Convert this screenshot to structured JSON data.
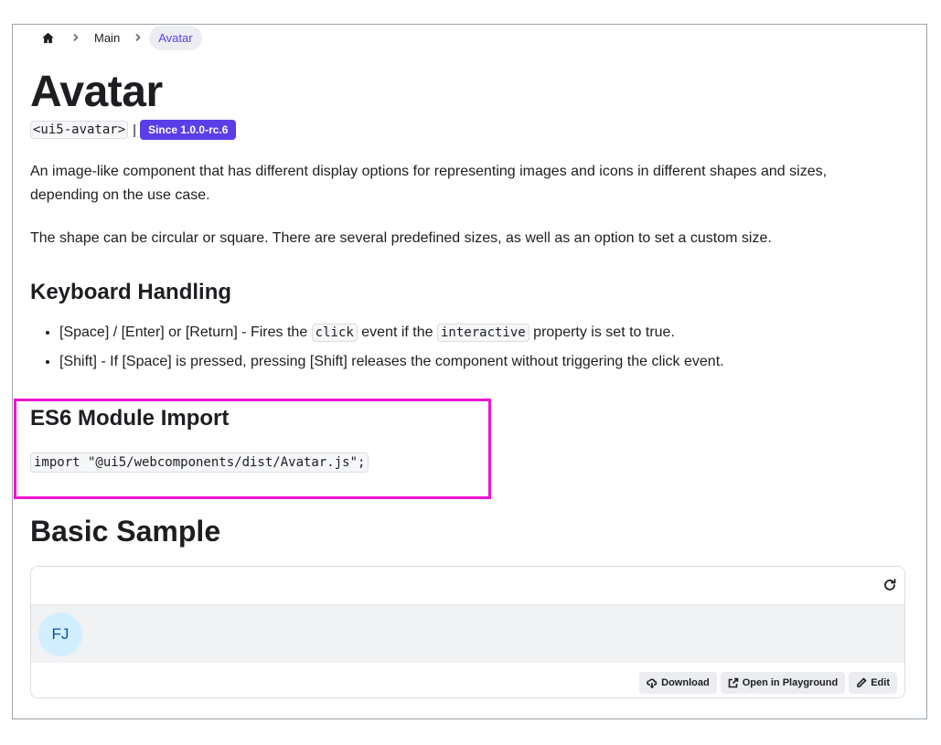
{
  "breadcrumb": {
    "home_icon": "home-icon",
    "items": [
      "Main",
      "Avatar"
    ]
  },
  "page": {
    "title": "Avatar",
    "tag": "<ui5-avatar>",
    "separator": "|",
    "since_badge": "Since 1.0.0-rc.6",
    "description": [
      "An image-like component that has different display options for representing images and icons in different shapes and sizes, depending on the use case.",
      "The shape can be circular or square. There are several predefined sizes, as well as an option to set a custom size."
    ]
  },
  "keyboard": {
    "heading": "Keyboard Handling",
    "item1": {
      "prefix": "[Space] / [Enter] or [Return] - Fires the ",
      "code1": "click",
      "middle": " event if the ",
      "code2": "interactive",
      "suffix": " property is set to true."
    },
    "item2": "[Shift] - If [Space] is pressed, pressing [Shift] releases the component without triggering the click event."
  },
  "import": {
    "heading": "ES6 Module Import",
    "code": "import \"@ui5/webcomponents/dist/Avatar.js\";"
  },
  "sample": {
    "heading": "Basic Sample",
    "avatar_initials": "FJ",
    "refresh_icon": "refresh-icon",
    "actions": {
      "download": "Download",
      "playground": "Open in Playground",
      "edit": "Edit"
    }
  },
  "colors": {
    "accent": "#5b3ee8",
    "highlight": "#f013d0",
    "avatar_bg": "#d1efff",
    "avatar_text": "#0f4fa8"
  }
}
